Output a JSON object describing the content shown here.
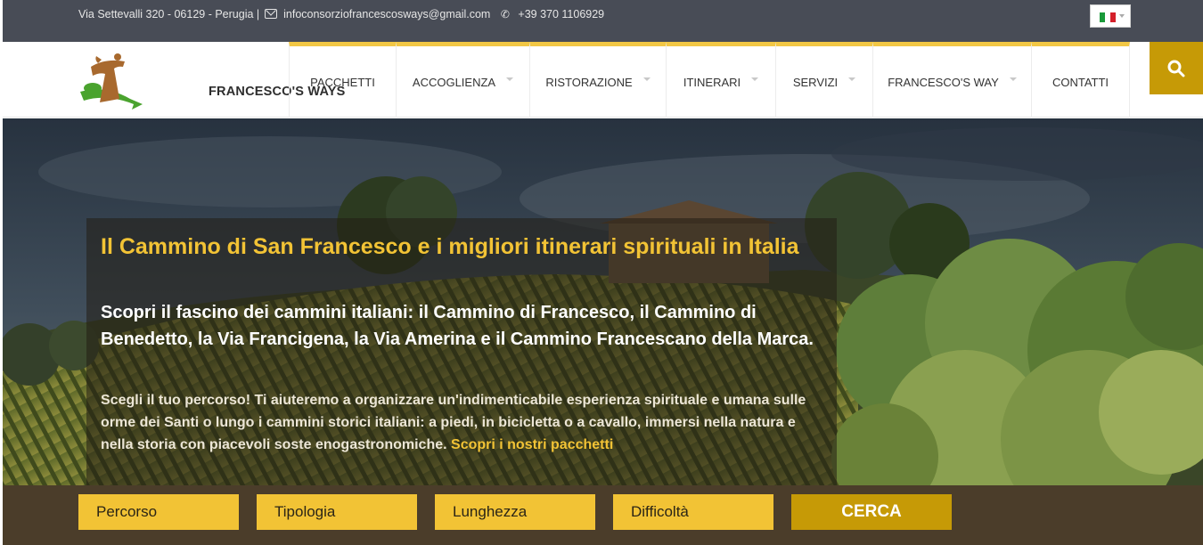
{
  "topbar": {
    "address": "Via Settevalli 320 - 06129 - Perugia |",
    "email": "infoconsorziofrancescosways@gmail.com",
    "phone": "+39 370 1106929",
    "language_flag": [
      "#1a9a3a",
      "#ffffff",
      "#d4202a"
    ]
  },
  "header": {
    "logo_text": "FRANCESCO'S WAYS",
    "nav": [
      {
        "label": "PACCHETTI",
        "dropdown": false
      },
      {
        "label": "ACCOGLIENZA",
        "dropdown": true
      },
      {
        "label": "RISTORAZIONE",
        "dropdown": true
      },
      {
        "label": "ITINERARI",
        "dropdown": true
      },
      {
        "label": "SERVIZI",
        "dropdown": true
      },
      {
        "label": "FRANCESCO'S WAY",
        "dropdown": true
      },
      {
        "label": "CONTATTI",
        "dropdown": false
      }
    ],
    "search_icon": "search-icon"
  },
  "hero": {
    "title": "Il Cammino di San Francesco e i migliori itinerari spirituali in Italia",
    "subtitle": "Scopri il fascino dei cammini italiani: il Cammino di Francesco, il Cammino di Benedetto, la Via Francigena, la Via Amerina e il Cammino Francescano della Marca.",
    "description": "Scegli il tuo percorso! Ti aiuteremo a organizzare un'indimenticabile esperienza spirituale e umana sulle orme dei Santi o lungo i cammini storici italiani: a piedi, in bicicletta o a cavallo, immersi nella natura e nella storia con piacevoli soste enogastronomiche.",
    "link": "Scopri i nostri pacchetti"
  },
  "search": {
    "filters": [
      "Percorso",
      "Tipologia",
      "Lunghezza",
      "Difficoltà"
    ],
    "button": "CERCA"
  },
  "colors": {
    "accent": "#f2c335",
    "accent_dark": "#c69a06",
    "topbar": "#484c56",
    "searchbar": "#4b3d2a"
  }
}
